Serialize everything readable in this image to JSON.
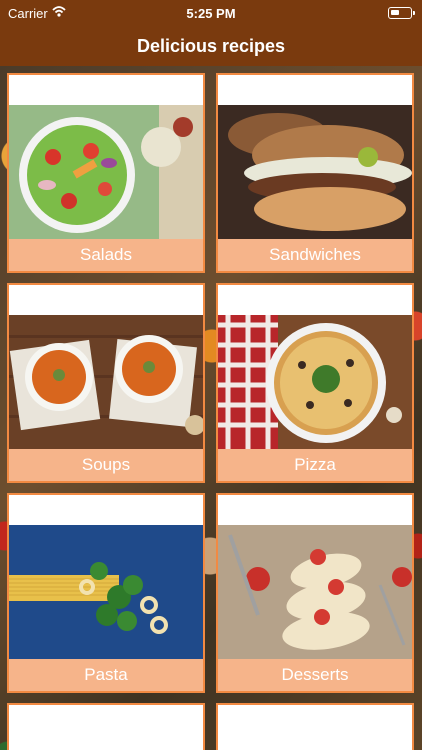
{
  "status_bar": {
    "carrier": "Carrier",
    "time": "5:25 PM"
  },
  "nav": {
    "title": "Delicious recipes"
  },
  "categories": [
    {
      "label": "Salads"
    },
    {
      "label": "Sandwiches"
    },
    {
      "label": "Soups"
    },
    {
      "label": "Pizza"
    },
    {
      "label": "Pasta"
    },
    {
      "label": "Desserts"
    }
  ],
  "colors": {
    "navbar": "#7a3a0e",
    "card_border": "#f28a42",
    "card_label": "#f6b48a"
  }
}
